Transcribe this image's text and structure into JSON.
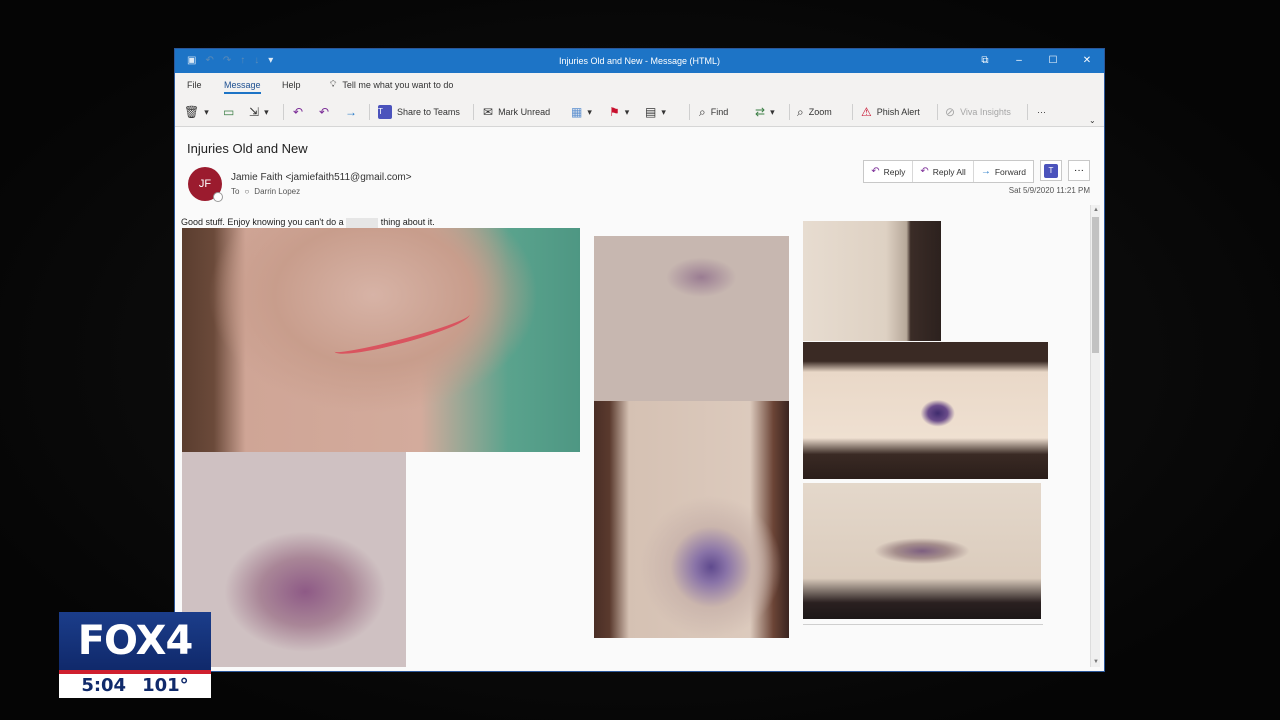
{
  "window": {
    "title": "Injuries Old and New  -  Message (HTML)",
    "controls": [
      "⧉",
      "–",
      "☐",
      "✕"
    ]
  },
  "menu": {
    "tabs": [
      "File",
      "Message",
      "Help"
    ],
    "active_tab": "Message",
    "tell_me": "Tell me what you want to do"
  },
  "ribbon": {
    "share_to_teams": "Share to Teams",
    "mark_unread": "Mark Unread",
    "find": "Find",
    "zoom": "Zoom",
    "phish_alert": "Phish Alert",
    "viva_insights": "Viva Insights",
    "more": "···"
  },
  "message": {
    "subject": "Injuries Old and New",
    "avatar_initials": "JF",
    "sender": "Jamie Faith <jamiefaith511@gmail.com>",
    "to_label": "To",
    "recipient": "Darrin Lopez",
    "date": "Sat 5/9/2020 11:21 PM",
    "reply": "Reply",
    "reply_all": "Reply All",
    "forward": "Forward",
    "body_before": "Good stuff. Enjoy knowing you can't do a",
    "body_after": "thing about it."
  },
  "colors": {
    "titlebar": "#1d74c6",
    "avatar": "#9b1b2e",
    "fox_blue": "#10296b",
    "fox_red": "#cf1f2e"
  },
  "bug": {
    "logo": "FOX4",
    "time": "5:04",
    "temp": "101°"
  }
}
